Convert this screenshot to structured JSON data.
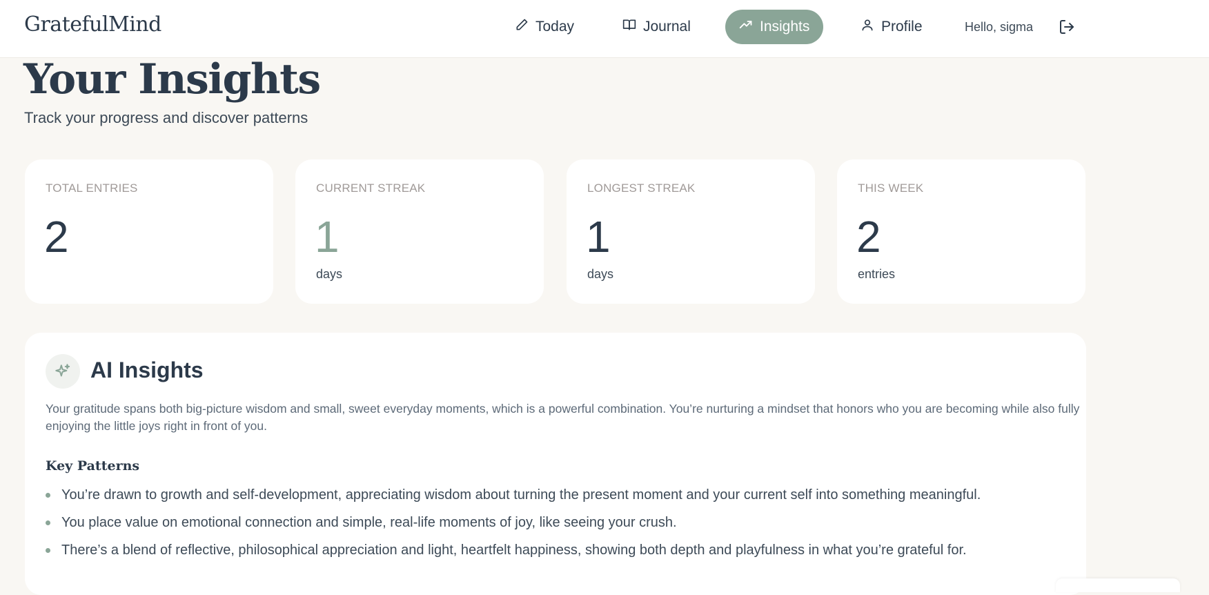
{
  "app": {
    "brand": "GratefulMind"
  },
  "nav": {
    "items": [
      {
        "label": "Today",
        "icon": "pencil-icon"
      },
      {
        "label": "Journal",
        "icon": "book-icon"
      },
      {
        "label": "Insights",
        "icon": "trending-up-icon",
        "active": true
      },
      {
        "label": "Profile",
        "icon": "user-icon"
      }
    ],
    "greeting": "Hello, sigma",
    "logout_icon": "logout-icon"
  },
  "page": {
    "title": "Your Insights",
    "subtitle": "Track your progress and discover patterns"
  },
  "stats": [
    {
      "label": "TOTAL ENTRIES",
      "value": "2",
      "unit": ""
    },
    {
      "label": "CURRENT STREAK",
      "value": "1",
      "unit": "days",
      "accent": true
    },
    {
      "label": "LONGEST STREAK",
      "value": "1",
      "unit": "days"
    },
    {
      "label": "THIS WEEK",
      "value": "2",
      "unit": "entries"
    }
  ],
  "ai": {
    "title": "AI Insights",
    "icon": "sparkles-icon",
    "summary": "Your gratitude spans both big-picture wisdom and small, sweet everyday moments, which is a powerful combination. You’re nurturing a mindset that honors who you are becoming while also fully enjoying the little joys right in front of you.",
    "key_patterns_title": "Key Patterns",
    "patterns": [
      "You’re drawn to growth and self-development, appreciating wisdom about turning the present moment and your current self into something meaningful.",
      "You place value on emotional connection and simple, real-life moments of joy, like seeing your crush.",
      "There’s a blend of reflective, philosophical appreciation and light, heartfelt happiness, showing both depth and playfulness in what you’re grateful for."
    ]
  },
  "colors": {
    "accent": "#8aa597",
    "text": "#2c3a4a",
    "background": "#f9f7f3",
    "card": "#ffffff",
    "muted_label": "#a09a98"
  }
}
